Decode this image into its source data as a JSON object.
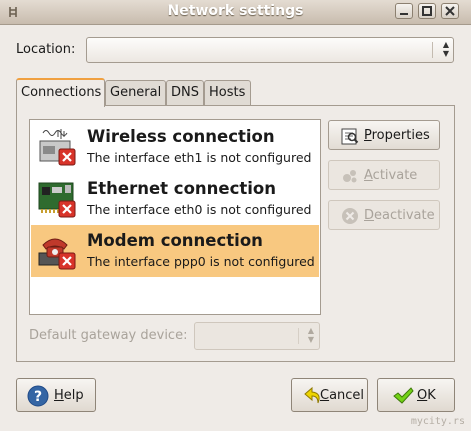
{
  "window": {
    "title": "Network settings"
  },
  "location": {
    "label": "Location:",
    "value": ""
  },
  "tabs": [
    {
      "label": "Connections",
      "active": true
    },
    {
      "label": "General",
      "active": false
    },
    {
      "label": "DNS",
      "active": false
    },
    {
      "label": "Hosts",
      "active": false
    }
  ],
  "connections": [
    {
      "name": "Wireless connection",
      "desc": "The interface eth1 is not configured",
      "icon": "wireless-card-icon",
      "selected": false
    },
    {
      "name": "Ethernet connection",
      "desc": "The interface eth0 is not configured",
      "icon": "ethernet-card-icon",
      "selected": false
    },
    {
      "name": "Modem connection",
      "desc": "The interface ppp0 is not configured",
      "icon": "modem-phone-icon",
      "selected": true
    }
  ],
  "side_buttons": {
    "properties": {
      "mn": "P",
      "rest": "roperties",
      "enabled": true
    },
    "activate": {
      "mn": "A",
      "rest": "ctivate",
      "enabled": false
    },
    "deactivate": {
      "mn": "D",
      "rest": "eactivate",
      "enabled": false
    }
  },
  "gateway": {
    "label": "Default gateway device:",
    "value": ""
  },
  "buttons": {
    "help": {
      "mn": "H",
      "rest": "elp"
    },
    "cancel": {
      "mn": "C",
      "rest": "ancel"
    },
    "ok": {
      "mn": "O",
      "rest": "K"
    }
  },
  "watermark": "mycity.rs",
  "colors": {
    "selection": "#f8c880",
    "tab_accent": "#f0a040",
    "error_badge": "#d8342a"
  }
}
